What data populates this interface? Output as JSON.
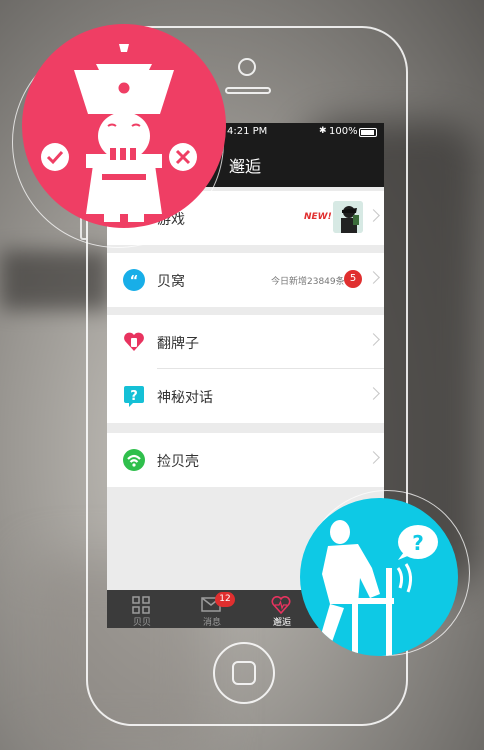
{
  "status_bar": {
    "time": "4:21 PM",
    "bluetooth": "✱",
    "battery": "100%"
  },
  "nav": {
    "title": "邂逅"
  },
  "menu": {
    "game": {
      "label": "游戏",
      "badge": "NEW!"
    },
    "beiwo": {
      "label": "贝窝",
      "subtitle": "今日新增23849条",
      "count": "5"
    },
    "fanpaizi": {
      "label": "翻牌子"
    },
    "shenmi": {
      "label": "神秘对话"
    },
    "jianbeike": {
      "label": "捡贝壳"
    }
  },
  "tabs": [
    {
      "label": "贝贝",
      "icon": "grid-icon"
    },
    {
      "label": "消息",
      "icon": "mail-icon",
      "badge": "12"
    },
    {
      "label": "邂逅",
      "icon": "heart-icon",
      "active": true
    }
  ],
  "colors": {
    "pink": "#ef3e64",
    "cyan": "#0ec9e5",
    "red": "#e02f2f",
    "bar": "#1b1b1b"
  }
}
